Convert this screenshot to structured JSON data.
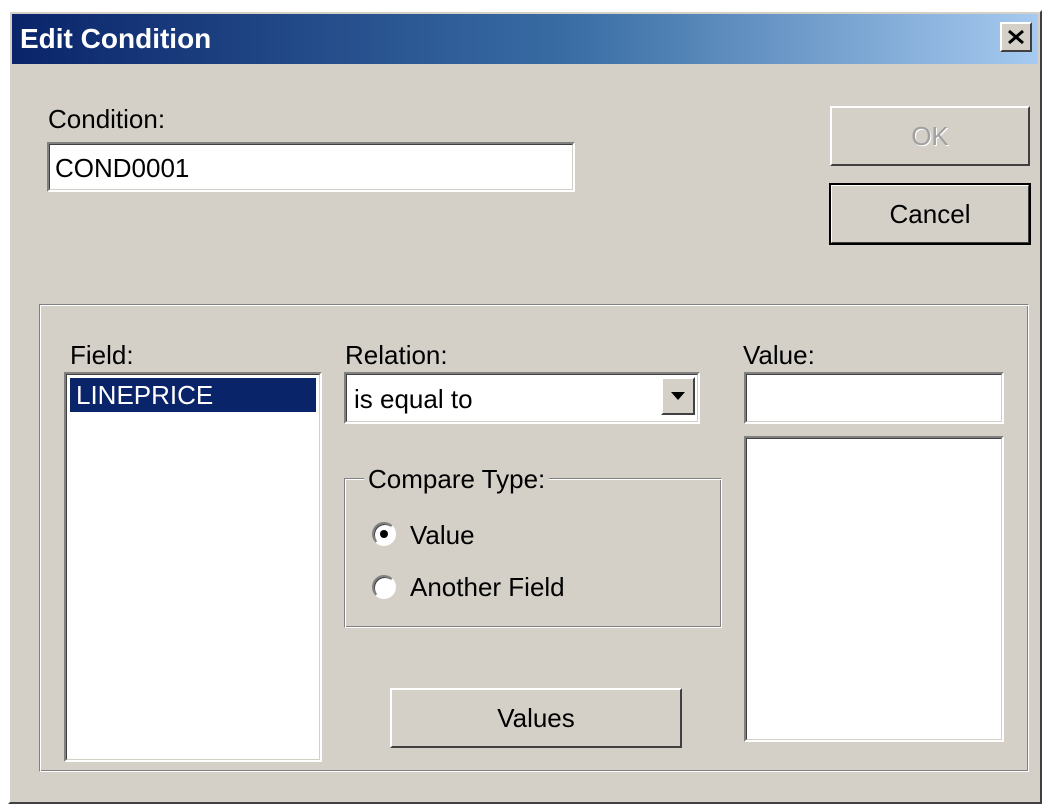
{
  "window": {
    "title": "Edit Condition"
  },
  "condition": {
    "label": "Condition:",
    "value": "COND0001"
  },
  "buttons": {
    "ok": "OK",
    "cancel": "Cancel",
    "values": "Values"
  },
  "field": {
    "label": "Field:",
    "items": [
      "LINEPRICE"
    ],
    "selected": "LINEPRICE"
  },
  "relation": {
    "label": "Relation:",
    "value": "is equal to"
  },
  "value": {
    "label": "Value:",
    "input": ""
  },
  "compare_type": {
    "label": "Compare Type:",
    "options": [
      {
        "label": "Value",
        "checked": true
      },
      {
        "label": "Another Field",
        "checked": false
      }
    ]
  }
}
